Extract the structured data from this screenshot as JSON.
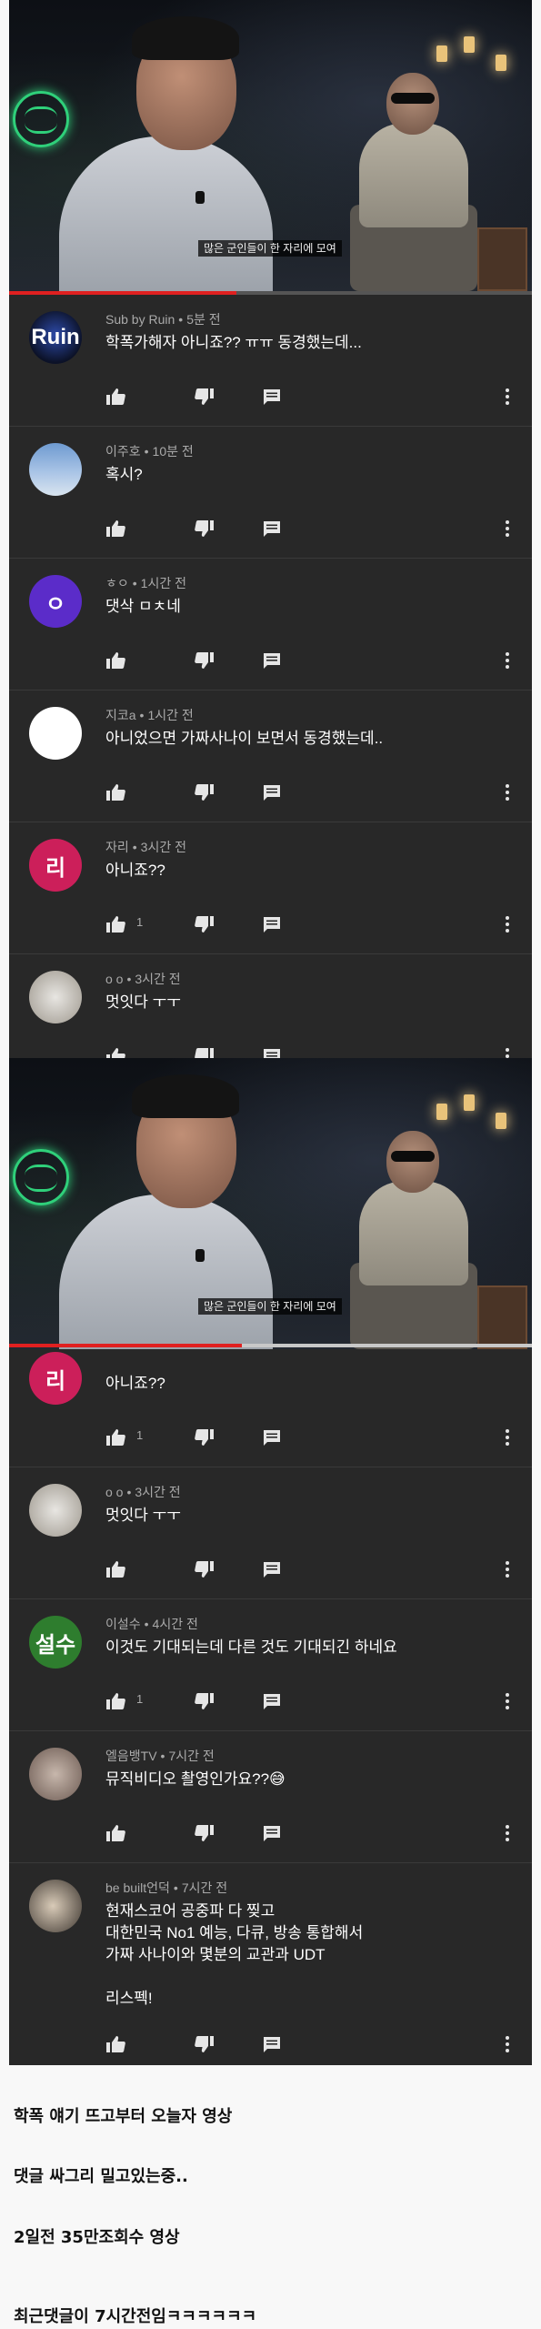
{
  "video": {
    "subtitle": "많은 군인들이 한 자리에 모여"
  },
  "screenshot1": {
    "comments": [
      {
        "author": "Sub by Ruin",
        "time": "5분 전",
        "text": "학폭가해자 아니죠?? ㅠㅠ 동경했는데...",
        "likes": "",
        "avatar": "Ruin"
      },
      {
        "author": "이주호",
        "time": "10분 전",
        "text": "혹시?",
        "likes": "",
        "avatar": ""
      },
      {
        "author": "ㅎㅇ",
        "time": "1시간 전",
        "text": "댓삭 ㅁㅊ네",
        "likes": "",
        "avatar": "ㅇ"
      },
      {
        "author": "지코a",
        "time": "1시간 전",
        "text": "아니었으면 가짜사나이 보면서 동경했는데..",
        "likes": "",
        "avatar": ""
      },
      {
        "author": "자리",
        "time": "3시간 전",
        "text": "아니죠??",
        "likes": "1",
        "avatar": "리"
      },
      {
        "author": "o o",
        "time": "3시간 전",
        "text": "멋잇다 ㅜㅜ",
        "likes": "",
        "avatar": ""
      }
    ]
  },
  "screenshot2": {
    "comments": [
      {
        "author": "",
        "time": "",
        "text": "아니죠??",
        "likes": "1",
        "avatar": "리"
      },
      {
        "author": "o o",
        "time": "3시간 전",
        "text": "멋잇다 ㅜㅜ",
        "likes": "",
        "avatar": ""
      },
      {
        "author": "이설수",
        "time": "4시간 전",
        "text": "이것도 기대되는데 다른 것도 기대되긴 하네요",
        "likes": "1",
        "avatar": "설수"
      },
      {
        "author": "엘음뱅TV",
        "time": "7시간 전",
        "text": "뮤직비디오 촬영인가요??😅",
        "likes": "",
        "avatar": ""
      },
      {
        "author": "be built언덕",
        "time": "7시간 전",
        "text_lines": [
          "현재스코어 공중파 다 찢고",
          "대한민국 No1 예능, 다큐, 방송 통합해서",
          "가짜 사나이와 몇분의 교관과 UDT",
          "",
          "리스펙!"
        ],
        "likes": "",
        "avatar": ""
      }
    ]
  },
  "captions": [
    "학폭 얘기 뜨고부터 오늘자 영상",
    "댓글 싸그리 밀고있는중..",
    "2일전 35만조회수 영상",
    "최근댓글이 7시간전임ㅋㅋㅋㅋㅋㅋ"
  ],
  "icons": {
    "like": "thumbs-up-icon",
    "dislike": "thumbs-down-icon",
    "reply": "reply-comment-icon",
    "more": "more-vertical-icon"
  },
  "colors": {
    "background": "#282828",
    "progress": "#e02020",
    "text": "#ffffff",
    "meta": "#aaaaaa"
  }
}
